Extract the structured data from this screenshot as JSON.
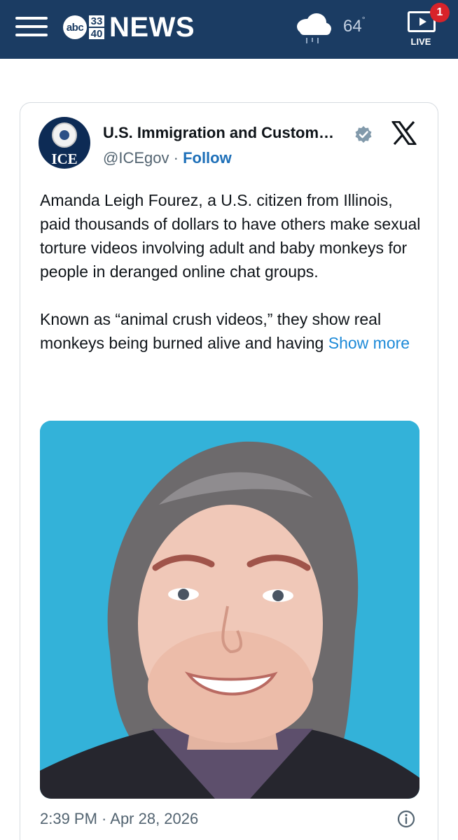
{
  "header": {
    "brand_abc": "abc",
    "brand_channel_top": "33",
    "brand_channel_bottom": "40",
    "brand_word": "NEWS",
    "weather_icon": "cloud-rain-icon",
    "temperature": "64",
    "temperature_unit": "°",
    "live_label": "LIVE",
    "live_badge_count": "1",
    "colors": {
      "bar": "#1b3c63",
      "badge": "#d8232a"
    }
  },
  "post": {
    "avatar_text": "ICE",
    "account_name": "U.S. Immigration and Custom…",
    "verified_icon": "verified-badge-icon",
    "platform_icon": "x-logo-icon",
    "handle": "@ICEgov",
    "separator": "·",
    "follow_label": "Follow",
    "paragraph_1": "Amanda Leigh Fourez, a U.S. citizen from Illinois, paid thousands of dollars to have others make sexual torture videos involving adult and baby monkeys for people in deranged online chat groups.",
    "paragraph_2": "Known as “animal crush videos,” they show real monkeys being burned alive and having ",
    "show_more_label": "Show more",
    "photo": "portrait photo of a woman against a blue background",
    "timestamp": "2:39 PM · Apr 28, 2026",
    "info_icon": "info-icon",
    "colors": {
      "link": "#1d6fb8",
      "show_more": "#1d8ad8",
      "photo_background": "#33b2d9"
    }
  }
}
